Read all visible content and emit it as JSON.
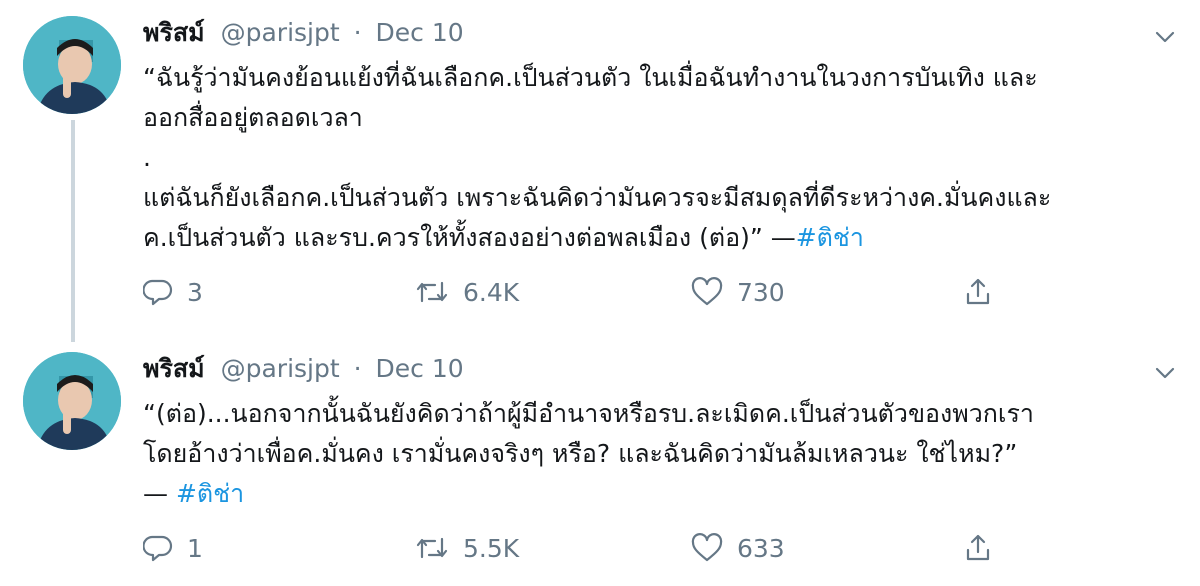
{
  "tweets": [
    {
      "author_name": "พริสม์",
      "handle": "@parisjpt",
      "separator": "·",
      "date": "Dec 10",
      "lines": [
        "“ฉันรู้ว่ามันคงย้อนแย้งที่ฉันเลือกค.เป็นส่วนตัว ในเมื่อฉันทำงานในวงการบันเทิง และ",
        "ออกสื่ออยู่ตลอดเวลา",
        ".",
        "แต่ฉันก็ยังเลือกค.เป็นส่วนตัว เพราะฉันคิดว่ามันควรจะมีสมดุลที่ดีระหว่างค.มั่นคงและ"
      ],
      "last_line_text": "ค.เป็นส่วนตัว และรบ.ควรให้ทั้งสองอย่างต่อพลเมือง (ต่อ)” —",
      "hashtag": "#ติช่า",
      "replies": "3",
      "retweets": "6.4K",
      "likes": "730"
    },
    {
      "author_name": "พริสม์",
      "handle": "@parisjpt",
      "separator": "·",
      "date": "Dec 10",
      "lines": [
        "“(ต่อ)...นอกจากนั้นฉันยังคิดว่าถ้าผู้มีอำนาจหรือรบ.ละเมิดค.เป็นส่วนตัวของพวกเรา",
        "โดยอ้างว่าเพื่อค.มั่นคง เรามั่นคงจริงๆ หรือ? และฉันคิดว่ามันล้มเหลวนะ ใช่ไหม?”"
      ],
      "last_line_text": "— ",
      "hashtag": "#ติช่า",
      "replies": "1",
      "retweets": "5.5K",
      "likes": "633"
    }
  ],
  "icons": {
    "reply": "reply-icon",
    "retweet": "retweet-icon",
    "like": "heart-icon",
    "share": "share-icon",
    "caret": "chevron-down-icon"
  },
  "colors": {
    "text": "#14171a",
    "secondary": "#657786",
    "hashtag": "#1b95e0",
    "thread_line": "#ccd6dd",
    "avatar_bg": "#4fb6c6"
  }
}
